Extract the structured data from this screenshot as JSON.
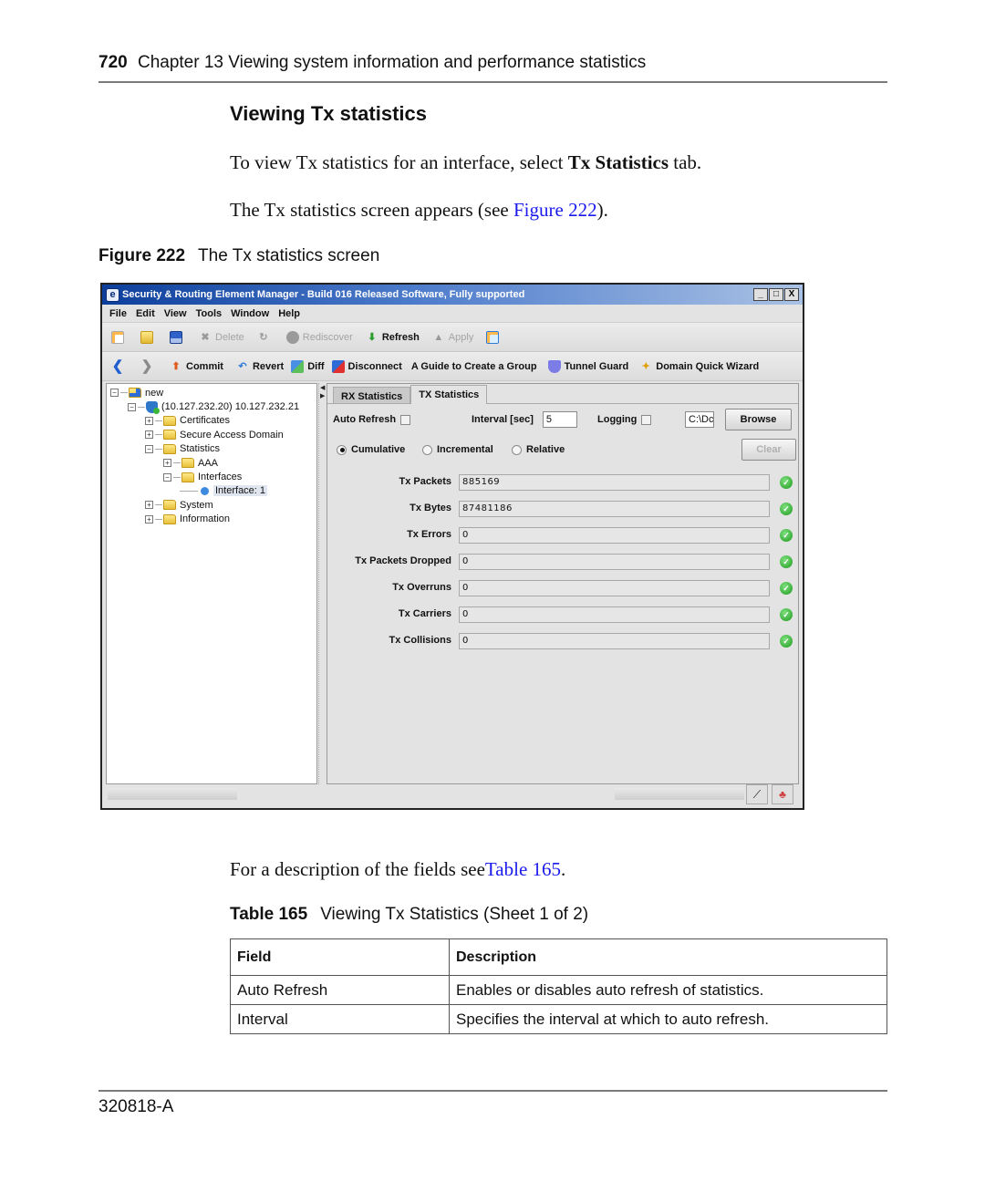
{
  "header": {
    "page_number": "720",
    "chapter": "Chapter 13  Viewing system information and performance statistics"
  },
  "section_title": "Viewing Tx statistics",
  "intro": {
    "p1_before": "To view Tx statistics for an interface, select ",
    "p1_bold": "Tx Statistics",
    "p1_after": " tab.",
    "p2_before": "The Tx statistics screen appears (see ",
    "p2_link": "Figure 222",
    "p2_after": ")."
  },
  "figure": {
    "number": "Figure 222",
    "caption": "The Tx statistics screen"
  },
  "app": {
    "title": "Security & Routing Element Manager - Build 016 Released Software, Fully supported",
    "window_buttons": {
      "minimize": "_",
      "maximize": "□",
      "close": "X"
    },
    "menu": [
      "File",
      "Edit",
      "View",
      "Tools",
      "Window",
      "Help"
    ],
    "toolbar1": {
      "delete": "Delete",
      "rediscover": "Rediscover",
      "refresh": "Refresh",
      "apply": "Apply"
    },
    "toolbar2": {
      "commit": "Commit",
      "revert": "Revert",
      "diff": "Diff",
      "disconnect": "Disconnect",
      "guide": "A Guide to Create a Group",
      "tunnel_guard": "Tunnel Guard",
      "domain_wizard": "Domain Quick Wizard"
    },
    "tree": {
      "root": "new",
      "device": "(10.127.232.20) 10.127.232.21",
      "certificates": "Certificates",
      "secure_access_domain": "Secure Access Domain",
      "statistics": "Statistics",
      "aaa": "AAA",
      "interfaces": "Interfaces",
      "interface1": "Interface: 1",
      "system": "System",
      "information": "Information"
    },
    "tabs": {
      "rx": "RX Statistics",
      "tx": "TX Statistics"
    },
    "options": {
      "auto_refresh_label": "Auto Refresh",
      "auto_refresh_checked": false,
      "interval_label": "Interval [sec]",
      "interval_value": "5",
      "logging_label": "Logging",
      "logging_checked": false,
      "log_path_value": "C:\\Dc",
      "browse": "Browse",
      "clear": "Clear",
      "modes": [
        "Cumulative",
        "Incremental",
        "Relative"
      ],
      "selected_mode": "Cumulative"
    },
    "stats": [
      {
        "label": "Tx Packets",
        "value": "885169",
        "status": "ok"
      },
      {
        "label": "Tx Bytes",
        "value": "87481186",
        "status": "ok"
      },
      {
        "label": "Tx Errors",
        "value": "0",
        "status": "ok"
      },
      {
        "label": "Tx Packets Dropped",
        "value": "0",
        "status": "ok"
      },
      {
        "label": "Tx Overruns",
        "value": "0",
        "status": "ok"
      },
      {
        "label": "Tx Carriers",
        "value": "0",
        "status": "ok"
      },
      {
        "label": "Tx Collisions",
        "value": "0",
        "status": "ok"
      }
    ]
  },
  "after_figure": {
    "p3_before": "For a description of the fields see",
    "p3_link": "Table 165",
    "p3_after": "."
  },
  "table": {
    "number": "Table 165",
    "caption": "Viewing Tx Statistics (Sheet 1 of 2)",
    "headers": [
      "Field",
      "Description"
    ],
    "rows": [
      [
        "Auto Refresh",
        "Enables or disables auto refresh of statistics."
      ],
      [
        "Interval",
        "Specifies the interval at which to auto refresh."
      ]
    ]
  },
  "footer": {
    "doc_id": "320818-A"
  },
  "colors": {
    "link": "#1a1aee",
    "title_bar": "#0c3f9c",
    "ok_status": "#1e9a1e"
  }
}
